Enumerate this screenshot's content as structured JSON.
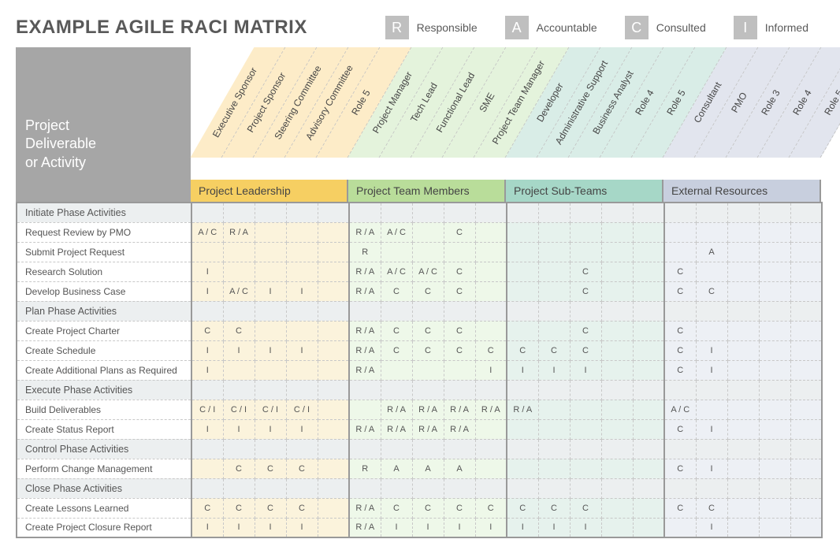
{
  "title": "EXAMPLE AGILE RACI MATRIX",
  "legend": [
    {
      "letter": "R",
      "label": "Responsible"
    },
    {
      "letter": "A",
      "label": "Accountable"
    },
    {
      "letter": "C",
      "label": "Consulted"
    },
    {
      "letter": "I",
      "label": "Informed"
    }
  ],
  "row_header": "Project Deliverable or Activity",
  "groups": [
    {
      "name": "Project Leadership",
      "class": "y",
      "roles": [
        "Executive Sponsor",
        "Project Sponsor",
        "Steering Committee",
        "Advisory Committee",
        "Role 5"
      ]
    },
    {
      "name": "Project Team Members",
      "class": "g",
      "roles": [
        "Project Manager",
        "Tech Lead",
        "Functional Lead",
        "SME",
        "Project Team Manager"
      ]
    },
    {
      "name": "Project Sub-Teams",
      "class": "t",
      "roles": [
        "Developer",
        "Administrative Support",
        "Business Analyst",
        "Role 4",
        "Role 5"
      ]
    },
    {
      "name": "External Resources",
      "class": "b",
      "roles": [
        "Consultant",
        "PMO",
        "Role 3",
        "Role 4",
        "Role 5"
      ]
    }
  ],
  "rows": [
    {
      "type": "phase",
      "label": "Initiate Phase Activities"
    },
    {
      "type": "act",
      "label": "Request Review by PMO",
      "cells": [
        "A / C",
        "R / A",
        "",
        "",
        "",
        "R / A",
        "A / C",
        "",
        "C",
        "",
        "",
        "",
        "",
        "",
        "",
        "",
        "",
        "",
        "",
        ""
      ]
    },
    {
      "type": "act",
      "label": "Submit Project Request",
      "cells": [
        "",
        "",
        "",
        "",
        "",
        "R",
        "",
        "",
        "",
        "",
        "",
        "",
        "",
        "",
        "",
        "",
        "A",
        "",
        "",
        ""
      ]
    },
    {
      "type": "act",
      "label": "Research Solution",
      "cells": [
        "I",
        "",
        "",
        "",
        "",
        "R / A",
        "A / C",
        "A / C",
        "C",
        "",
        "",
        "",
        "C",
        "",
        "",
        "C",
        "",
        "",
        "",
        ""
      ]
    },
    {
      "type": "act",
      "label": "Develop Business Case",
      "cells": [
        "I",
        "A / C",
        "I",
        "I",
        "",
        "R / A",
        "C",
        "C",
        "C",
        "",
        "",
        "",
        "C",
        "",
        "",
        "C",
        "C",
        "",
        "",
        ""
      ]
    },
    {
      "type": "phase",
      "label": "Plan Phase Activities"
    },
    {
      "type": "act",
      "label": "Create Project Charter",
      "cells": [
        "C",
        "C",
        "",
        "",
        "",
        "R / A",
        "C",
        "C",
        "C",
        "",
        "",
        "",
        "C",
        "",
        "",
        "C",
        "",
        "",
        "",
        ""
      ]
    },
    {
      "type": "act",
      "label": "Create Schedule",
      "cells": [
        "I",
        "I",
        "I",
        "I",
        "",
        "R / A",
        "C",
        "C",
        "C",
        "C",
        "C",
        "C",
        "C",
        "",
        "",
        "C",
        "I",
        "",
        "",
        ""
      ]
    },
    {
      "type": "act",
      "label": "Create Additional Plans as Required",
      "cells": [
        "I",
        "",
        "",
        "",
        "",
        "R / A",
        "",
        "",
        "",
        "I",
        "I",
        "I",
        "I",
        "",
        "",
        "C",
        "I",
        "",
        "",
        ""
      ]
    },
    {
      "type": "phase",
      "label": "Execute Phase Activities"
    },
    {
      "type": "act",
      "label": "Build Deliverables",
      "cells": [
        "C / I",
        "C / I",
        "C / I",
        "C / I",
        "",
        "",
        "R / A",
        "R / A",
        "R / A",
        "R / A",
        "R / A",
        "",
        "",
        "",
        "",
        "A / C",
        "",
        "",
        "",
        ""
      ]
    },
    {
      "type": "act",
      "label": "Create Status Report",
      "cells": [
        "I",
        "I",
        "I",
        "I",
        "",
        "R / A",
        "R / A",
        "R / A",
        "R / A",
        "",
        "",
        "",
        "",
        "",
        "",
        "C",
        "I",
        "",
        "",
        ""
      ]
    },
    {
      "type": "phase",
      "label": "Control Phase Activities"
    },
    {
      "type": "act",
      "label": "Perform Change Management",
      "cells": [
        "",
        "C",
        "C",
        "C",
        "",
        "R",
        "A",
        "A",
        "A",
        "",
        "",
        "",
        "",
        "",
        "",
        "C",
        "I",
        "",
        "",
        ""
      ]
    },
    {
      "type": "phase",
      "label": "Close Phase Activities"
    },
    {
      "type": "act",
      "label": "Create Lessons Learned",
      "cells": [
        "C",
        "C",
        "C",
        "C",
        "",
        "R / A",
        "C",
        "C",
        "C",
        "C",
        "C",
        "C",
        "C",
        "",
        "",
        "C",
        "C",
        "",
        "",
        ""
      ]
    },
    {
      "type": "act",
      "label": "Create Project Closure Report",
      "cells": [
        "I",
        "I",
        "I",
        "I",
        "",
        "R / A",
        "I",
        "I",
        "I",
        "I",
        "I",
        "I",
        "I",
        "",
        "",
        "",
        "I",
        "",
        "",
        ""
      ]
    }
  ],
  "chart_data": {
    "type": "table",
    "title": "EXAMPLE AGILE RACI MATRIX"
  }
}
